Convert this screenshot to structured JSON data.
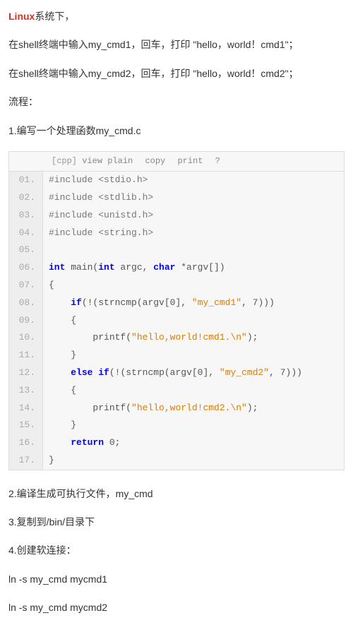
{
  "intro": {
    "linux_label": "Linux",
    "p1_suffix": "系统下，",
    "p2": "在shell终端中输入my_cmd1，回车，打印 \"hello，world！cmd1\"；",
    "p3": "在shell终端中输入my_cmd2，回车，打印 \"hello，world！cmd2\"；",
    "p4": "流程：",
    "p5": "1.编写一个处理函数my_cmd.c"
  },
  "toolbar": {
    "lang": "[cpp]",
    "view": "view plain",
    "copy": "copy",
    "print": "print",
    "help": "?"
  },
  "code": [
    {
      "n": "01.",
      "seg": [
        [
          "inc",
          "#include <stdio.h>"
        ]
      ]
    },
    {
      "n": "02.",
      "seg": [
        [
          "inc",
          "#include <stdlib.h>"
        ]
      ]
    },
    {
      "n": "03.",
      "seg": [
        [
          "inc",
          "#include <unistd.h>"
        ]
      ]
    },
    {
      "n": "04.",
      "seg": [
        [
          "inc",
          "#include <string.h>"
        ]
      ]
    },
    {
      "n": "05.",
      "seg": [
        [
          "",
          ""
        ]
      ]
    },
    {
      "n": "06.",
      "seg": [
        [
          "kw",
          "int"
        ],
        [
          "",
          " main("
        ],
        [
          "kw",
          "int"
        ],
        [
          "",
          " argc, "
        ],
        [
          "kw",
          "char"
        ],
        [
          "",
          " *argv[])"
        ]
      ]
    },
    {
      "n": "07.",
      "seg": [
        [
          "",
          "{"
        ]
      ]
    },
    {
      "n": "08.",
      "seg": [
        [
          "",
          "    "
        ],
        [
          "kw",
          "if"
        ],
        [
          "",
          "(!(strncmp(argv[0], "
        ],
        [
          "str",
          "\"my_cmd1\""
        ],
        [
          "",
          ", 7)))"
        ]
      ]
    },
    {
      "n": "09.",
      "seg": [
        [
          "",
          "    {"
        ]
      ]
    },
    {
      "n": "10.",
      "seg": [
        [
          "",
          "        printf("
        ],
        [
          "str",
          "\"hello,world!cmd1.\\n\""
        ],
        [
          "",
          ");"
        ]
      ]
    },
    {
      "n": "11.",
      "seg": [
        [
          "",
          "    }"
        ]
      ]
    },
    {
      "n": "12.",
      "seg": [
        [
          "",
          "    "
        ],
        [
          "kw",
          "else"
        ],
        [
          "",
          " "
        ],
        [
          "kw",
          "if"
        ],
        [
          "",
          "(!(strncmp(argv[0], "
        ],
        [
          "str",
          "\"my_cmd2\""
        ],
        [
          "",
          ", 7)))"
        ]
      ]
    },
    {
      "n": "13.",
      "seg": [
        [
          "",
          "    {"
        ]
      ]
    },
    {
      "n": "14.",
      "seg": [
        [
          "",
          "        printf("
        ],
        [
          "str",
          "\"hello,world!cmd2.\\n\""
        ],
        [
          "",
          ");"
        ]
      ]
    },
    {
      "n": "15.",
      "seg": [
        [
          "",
          "    }"
        ]
      ]
    },
    {
      "n": "16.",
      "seg": [
        [
          "",
          "    "
        ],
        [
          "kw",
          "return"
        ],
        [
          "",
          " 0;"
        ]
      ]
    },
    {
      "n": "17.",
      "seg": [
        [
          "",
          "}"
        ]
      ]
    }
  ],
  "steps": {
    "s2": "2.编译生成可执行文件，my_cmd",
    "s3": "3.复制到/bin/目录下",
    "s4": "4.创建软连接：",
    "s5": "ln -s my_cmd mycmd1",
    "s6": "ln -s my_cmd mycmd2"
  }
}
